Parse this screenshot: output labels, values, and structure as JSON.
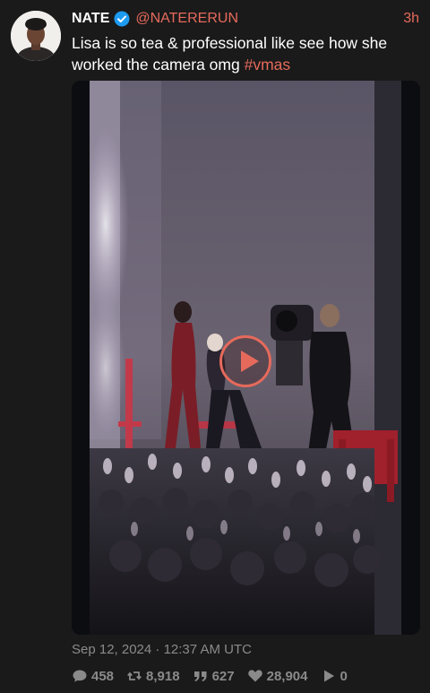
{
  "tweet": {
    "display_name": "NATE",
    "handle": "@NATERERUN",
    "time_ago": "3h",
    "text_main": "Lisa is so tea & professional like see how she worked the camera omg ",
    "hashtag": "#vmas",
    "timestamp": "Sep 12, 2024 · 12:37 AM UTC"
  },
  "stats": {
    "comments": "458",
    "retweets": "8,918",
    "quotes": "627",
    "likes": "28,904",
    "plays": "0"
  },
  "colors": {
    "accent": "#e66a5c",
    "background": "#1a1a1a",
    "muted": "#8a8a8a",
    "verified": "#1d9bf0"
  },
  "icons": {
    "verified": "verified-badge-icon",
    "play": "play-icon",
    "comment": "comment-icon",
    "retweet": "retweet-icon",
    "quote": "quote-icon",
    "like": "heart-icon",
    "views": "play-count-icon"
  }
}
